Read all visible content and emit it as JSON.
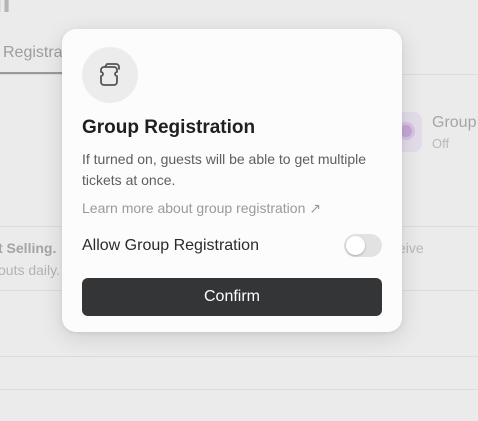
{
  "background": {
    "page_title": "ıl",
    "tab_label": "Registra",
    "group_setting": {
      "title": "Group",
      "status": "Off"
    },
    "selling_label": "t Selling.",
    "payouts_text": "outs daily.",
    "receive_text": "eive"
  },
  "modal": {
    "icon": "ticket-icon",
    "title": "Group Registration",
    "description": "If turned on, guests will be able to get multiple tickets at once.",
    "learn_more_link": "Learn more about group registration ↗",
    "toggle": {
      "label": "Allow Group Registration",
      "checked": false
    },
    "confirm_label": "Confirm"
  },
  "colors": {
    "confirm_button": "#343536",
    "modal_background": "#fcfcfc",
    "toggle_off": "#e2e2e2"
  }
}
